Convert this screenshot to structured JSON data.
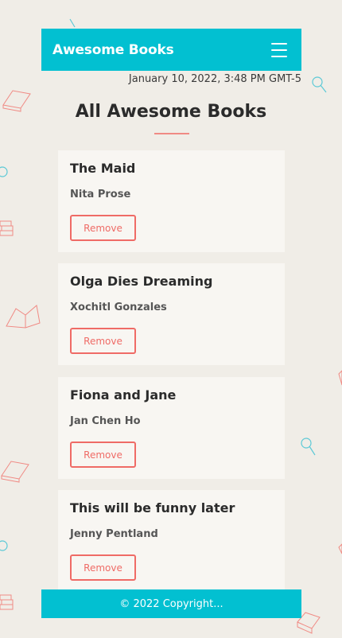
{
  "navbar": {
    "brand": "Awesome Books",
    "menu_icon": "hamburger-menu-icon"
  },
  "datetime": "January 10, 2022, 3:48 PM GMT-5",
  "main": {
    "title": "All Awesome Books",
    "books": [
      {
        "title": "The Maid",
        "author": "Nita Prose",
        "remove_label": "Remove"
      },
      {
        "title": "Olga Dies Dreaming",
        "author": "Xochitl Gonzales",
        "remove_label": "Remove"
      },
      {
        "title": "Fiona and Jane",
        "author": "Jan Chen Ho",
        "remove_label": "Remove"
      },
      {
        "title": "This will be funny later",
        "author": "Jenny Pentland",
        "remove_label": "Remove"
      }
    ]
  },
  "footer": {
    "copyright": "© 2022 Copyright..."
  },
  "colors": {
    "accent": "#02c0d1",
    "danger": "#ef6b66",
    "background": "#f0ede7",
    "card": "#f8f6f2"
  }
}
